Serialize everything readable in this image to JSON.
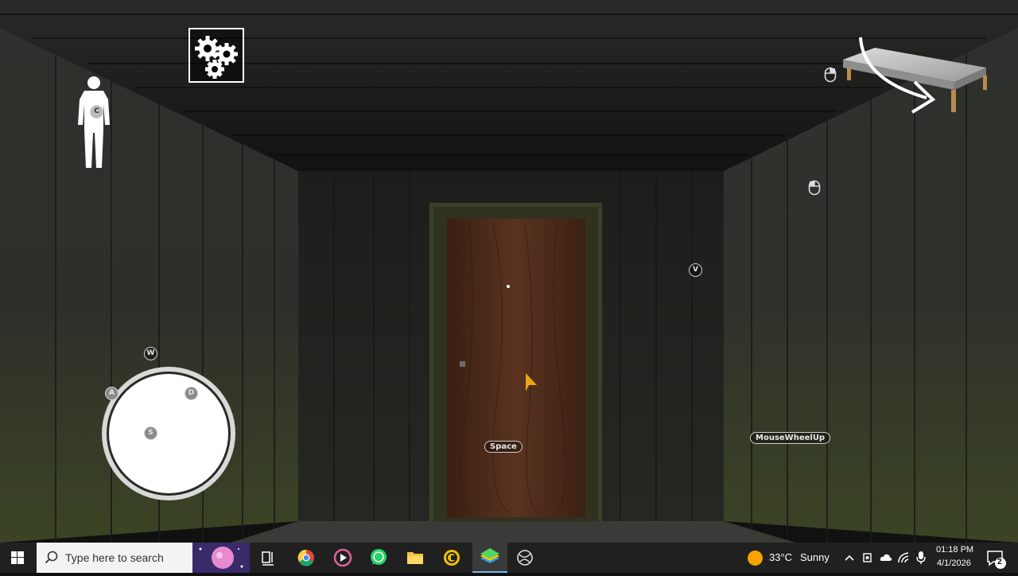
{
  "hud": {
    "crouch_key": "C",
    "move_keys": {
      "up": "W",
      "left": "A",
      "right": "D",
      "down": "S"
    },
    "view_key": "V",
    "jump_key": "Space",
    "scroll_key": "MouseWheelUp"
  },
  "taskbar": {
    "search_placeholder": "Type here to search",
    "weather_temp": "33°C",
    "weather_desc": "Sunny",
    "time": "01:18 PM",
    "date": "4/1/2026",
    "notification_count": "2"
  },
  "colors": {
    "wall": "#2b2d2a",
    "door": "#4a2a18",
    "taskbar": "#202020",
    "accent_cursor": "#e8a317"
  }
}
